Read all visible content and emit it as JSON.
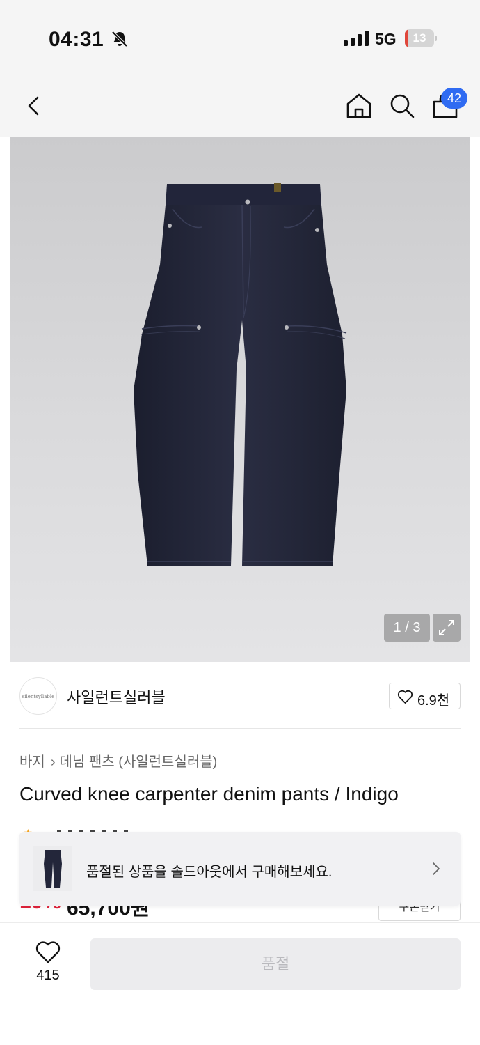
{
  "status_bar": {
    "time": "04:31",
    "network": "5G",
    "battery": "13",
    "battery_level": 0.13,
    "icons": [
      "bell-off-icon",
      "signal-icon",
      "battery-icon"
    ]
  },
  "header": {
    "icons": [
      "back-icon",
      "home-icon",
      "search-icon",
      "cart-icon"
    ],
    "cart_count": "42"
  },
  "gallery": {
    "page_indicator": "1 / 3",
    "image_subject": "pants-image"
  },
  "brand": {
    "logo_text": "silentsyllable",
    "name": "사일런트실러블",
    "likes": "6.9천"
  },
  "product": {
    "category": "바지",
    "subcategory": "데님 팬츠 (사일런트실러블)",
    "title": "Curved knee carpenter denim pants / Indigo",
    "discount": "10%",
    "price": "65,700원",
    "coupon_label": "쿠폰받기"
  },
  "toast": {
    "message": "품절된 상품을 솔드아웃에서 구매해보세요."
  },
  "bottom_bar": {
    "wish_count": "415",
    "buy_label": "품절"
  },
  "colors": {
    "accent": "#2f6bf2",
    "discount": "#e0223a",
    "denim": "#23263a",
    "disabled_bg": "#ececee",
    "disabled_text": "#b9b9bd"
  }
}
